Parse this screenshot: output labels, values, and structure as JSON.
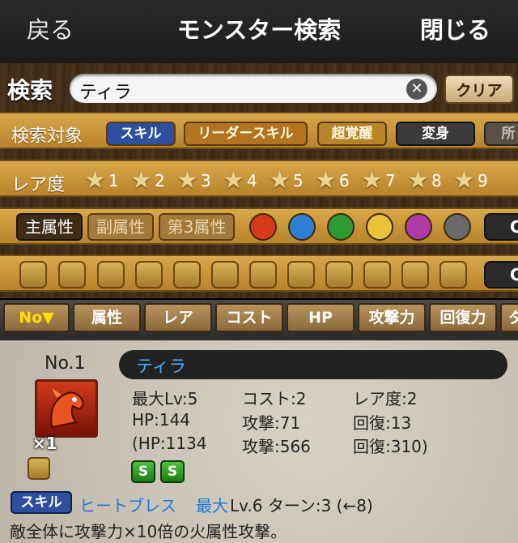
{
  "nav": {
    "back": "戻る",
    "title": "モンスター検索",
    "close": "閉じる"
  },
  "search": {
    "label": "検索",
    "value": "ティラ",
    "clear_label": "クリア"
  },
  "target": {
    "label": "検索対象",
    "chips": [
      "スキル",
      "リーダースキル",
      "超覚醒",
      "変身",
      "所"
    ]
  },
  "rarity": {
    "label": "レア度",
    "levels": [
      "1",
      "2",
      "3",
      "4",
      "5",
      "6",
      "7",
      "8",
      "9"
    ]
  },
  "attributes": {
    "main": "主属性",
    "sub": "副属性",
    "third": "第3属性",
    "orbs": [
      {
        "name": "fire",
        "color": "#d63a18"
      },
      {
        "name": "water",
        "color": "#2f7fd4"
      },
      {
        "name": "wood",
        "color": "#2e9a32"
      },
      {
        "name": "light",
        "color": "#e8c23a"
      },
      {
        "name": "dark",
        "color": "#b03aa6"
      },
      {
        "name": "none",
        "color": "#6a6a6a"
      }
    ],
    "toggle": "C"
  },
  "awakenings": {
    "toggle": "C"
  },
  "sort": {
    "tabs": [
      "No▼",
      "属性",
      "レア",
      "コスト",
      "HP",
      "攻撃力",
      "回復力",
      "ダ"
    ]
  },
  "result": {
    "no": "No.1",
    "name": "ティラ",
    "count": "×1",
    "max_lv": "最大Lv:5",
    "cost": "コスト:2",
    "rarity": "レア度:2",
    "hp": "HP:144",
    "atk": "攻撃:71",
    "rcv": "回復:13",
    "hp_max": "(HP:1134",
    "atk_max": "攻撃:566",
    "rcv_max": "回復:310)",
    "s_icon": "S",
    "skill_label": "スキル",
    "skill_name": "ヒートブレス",
    "skill_max": "最大",
    "skill_lv": "Lv.6 ターン:3 (←8)",
    "skill_desc": "敵全体に攻撃力×10倍の火属性攻撃。"
  }
}
